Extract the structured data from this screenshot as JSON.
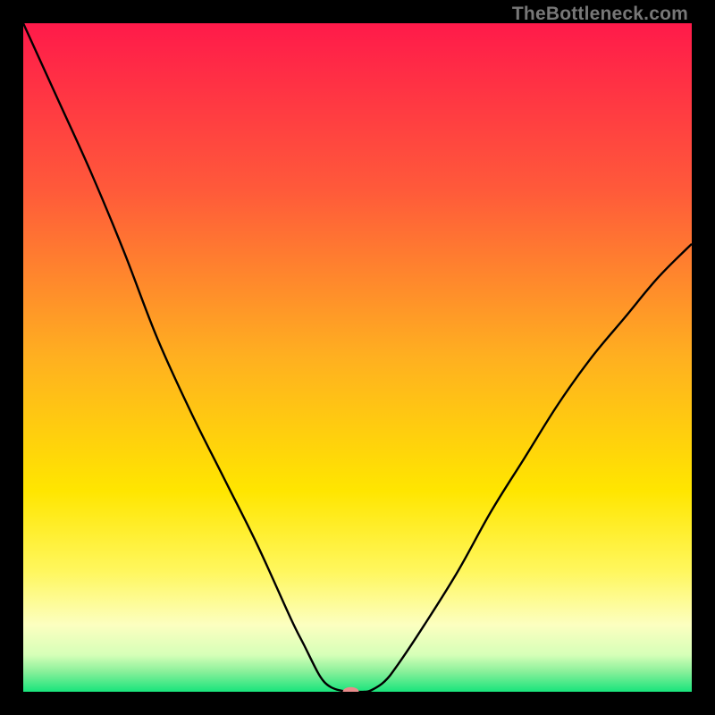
{
  "watermark": "TheBottleneck.com",
  "chart_data": {
    "type": "line",
    "title": "",
    "xlabel": "",
    "ylabel": "",
    "xlim": [
      0,
      100
    ],
    "ylim": [
      0,
      100
    ],
    "grid": false,
    "legend": false,
    "background_gradient_stops": [
      {
        "offset": 0.0,
        "color": "#ff1a4a"
      },
      {
        "offset": 0.25,
        "color": "#ff5a3a"
      },
      {
        "offset": 0.5,
        "color": "#ffb020"
      },
      {
        "offset": 0.7,
        "color": "#ffe600"
      },
      {
        "offset": 0.82,
        "color": "#fff75e"
      },
      {
        "offset": 0.9,
        "color": "#fcffc0"
      },
      {
        "offset": 0.945,
        "color": "#d6ffb8"
      },
      {
        "offset": 0.97,
        "color": "#89f09a"
      },
      {
        "offset": 1.0,
        "color": "#19e47c"
      }
    ],
    "series": [
      {
        "name": "bottleneck-curve",
        "color": "#000000",
        "x": [
          0,
          5,
          10,
          15,
          20,
          25,
          30,
          35,
          40,
          42,
          44,
          45,
          46,
          47,
          48,
          49,
          50,
          51,
          52,
          54,
          56,
          60,
          65,
          70,
          75,
          80,
          85,
          90,
          95,
          100
        ],
        "y": [
          100,
          89,
          78,
          66,
          53,
          42,
          32,
          22,
          11,
          7,
          3,
          1.5,
          0.7,
          0.3,
          0.1,
          0,
          0,
          0,
          0.2,
          1.5,
          4,
          10,
          18,
          27,
          35,
          43,
          50,
          56,
          62,
          67
        ]
      }
    ],
    "marker": {
      "name": "optimal-marker",
      "x": 49,
      "y": 0,
      "color": "#e98b8b",
      "rx": 1.2,
      "ry": 0.7
    }
  }
}
